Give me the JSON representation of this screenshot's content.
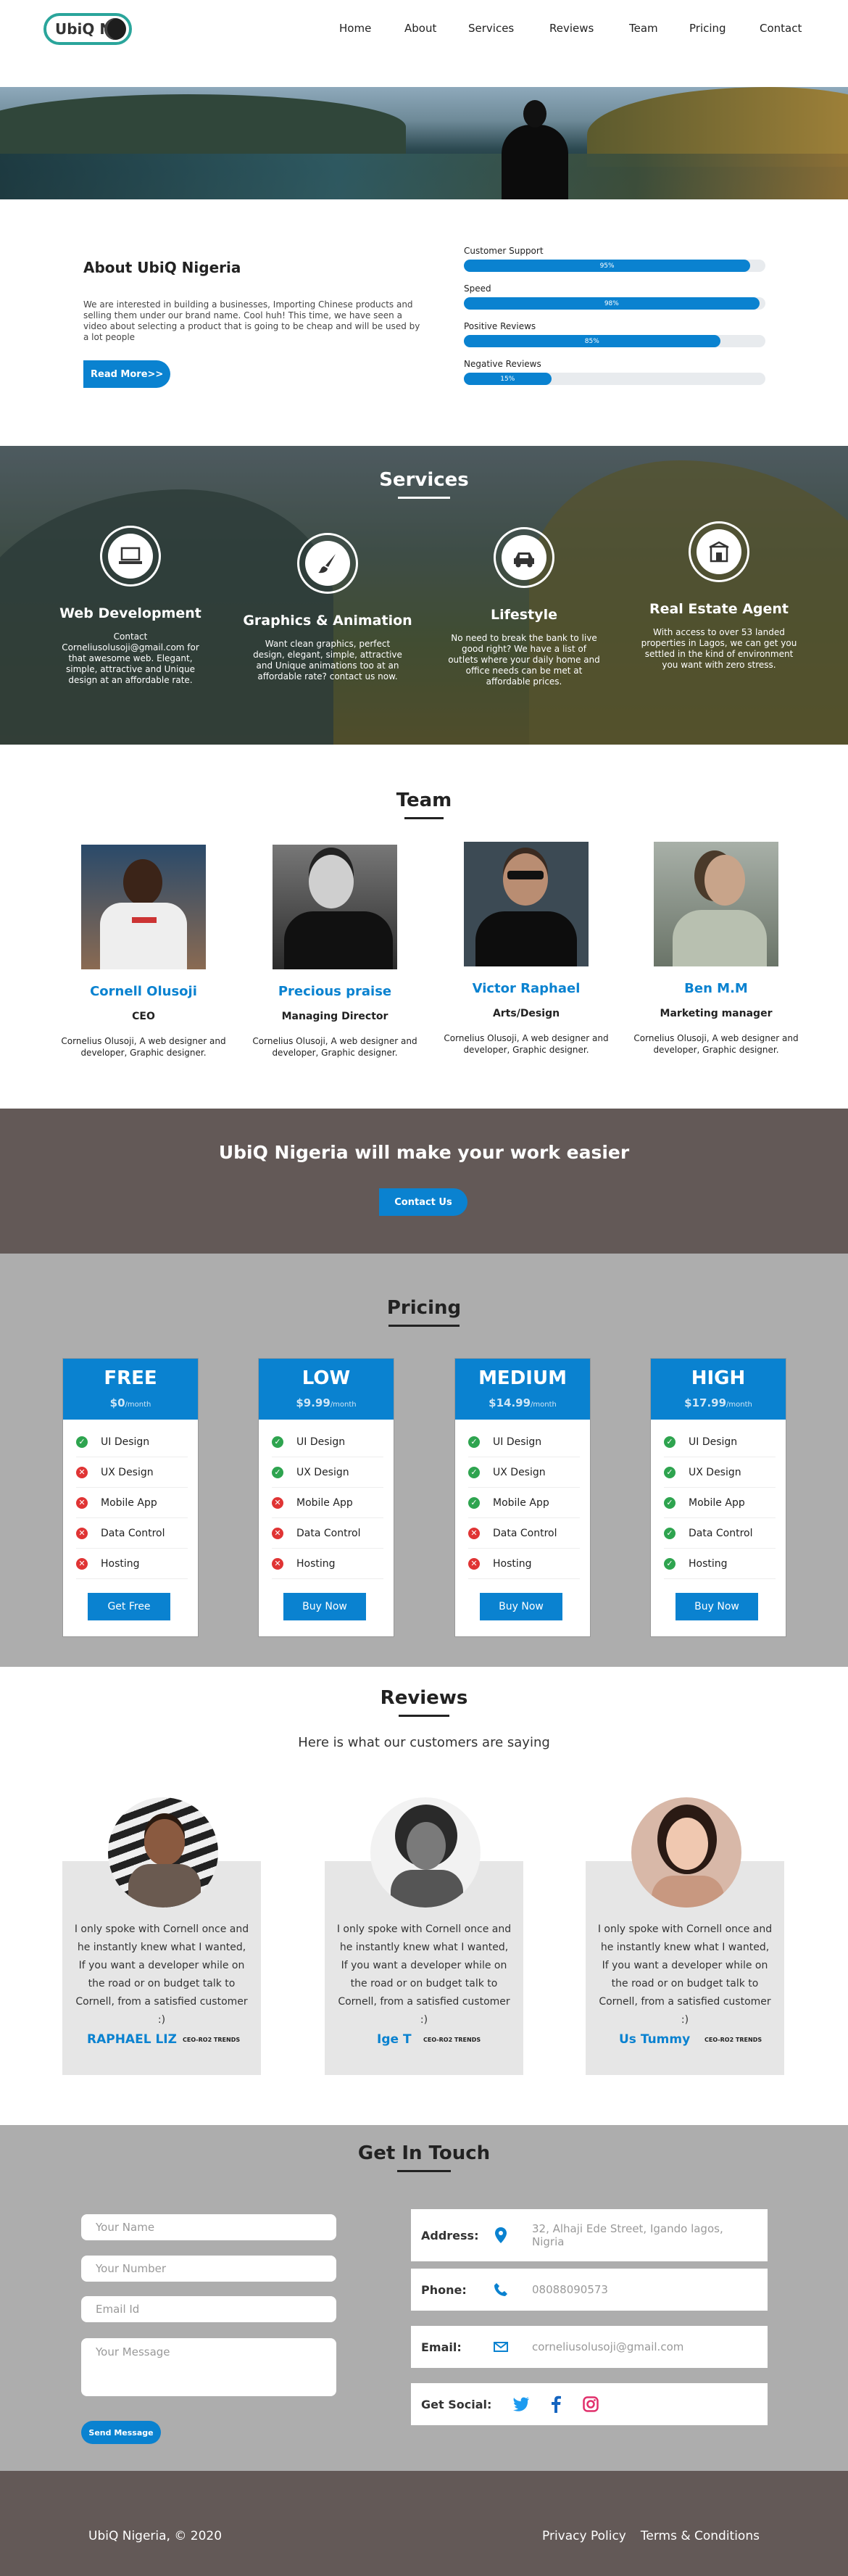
{
  "nav": {
    "logo_text": "UbiQ NG",
    "links": [
      "Home",
      "About",
      "Services",
      "Reviews",
      "Team",
      "Pricing",
      "Contact"
    ]
  },
  "about": {
    "title": "About UbiQ Nigeria",
    "text": "We are interested in building a businesses, Importing Chinese products and selling them under our brand name. Cool huh! This time, we have seen a video about selecting a product that is going to be cheap and will be used by a lot people",
    "button": "Read More>>",
    "skills": [
      {
        "label": "Customer Support",
        "value": "95%",
        "fraction": 0.95
      },
      {
        "label": "Speed",
        "value": "98%",
        "fraction": 0.98
      },
      {
        "label": "Positive Reviews",
        "value": "85%",
        "fraction": 0.85
      },
      {
        "label": "Negative Reviews",
        "value": "15%",
        "fraction": 0.29
      }
    ]
  },
  "services": {
    "title": "Services",
    "items": [
      {
        "title": "Web Development",
        "text": "Contact Corneliusolusoji@gmail.com for that awesome web. Elegant, simple, attractive and Unique design at an affordable rate.",
        "icon": "laptop-icon"
      },
      {
        "title": "Graphics & Animation",
        "text": "Want clean graphics, perfect design, elegant, simple, attractive and Unique animations too at an affordable rate? contact us now.",
        "icon": "paintbrush-icon"
      },
      {
        "title": "Lifestyle",
        "text": "No need to break the bank to live good right? We have a list of outlets where your daily home and office needs can be met at affordable prices.",
        "icon": "car-icon"
      },
      {
        "title": "Real Estate Agent",
        "text": "With access to over 53 landed properties in Lagos, we can get you settled in the kind of environment you want with zero stress.",
        "icon": "house-icon"
      }
    ]
  },
  "team": {
    "title": "Team",
    "members": [
      {
        "name": "Cornell Olusoji",
        "role": "CEO",
        "bio": "Cornelius Olusoji, A web designer and developer, Graphic designer."
      },
      {
        "name": "Precious praise",
        "role": "Managing Director",
        "bio": "Cornelius Olusoji, A web designer and developer, Graphic designer."
      },
      {
        "name": "Victor Raphael",
        "role": "Arts/Design",
        "bio": "Cornelius Olusoji, A web designer and developer, Graphic designer."
      },
      {
        "name": "Ben M.M",
        "role": "Marketing manager",
        "bio": "Cornelius Olusoji, A web designer and developer, Graphic designer."
      }
    ]
  },
  "cta": {
    "title": "UbiQ Nigeria will make your work easier",
    "button": "Contact Us"
  },
  "pricing": {
    "title": "Pricing",
    "features": [
      "UI Design",
      "UX Design",
      "Mobile App",
      "Data Control",
      "Hosting"
    ],
    "plans": [
      {
        "name": "FREE",
        "price": "$0",
        "per": "/month",
        "included": [
          true,
          false,
          false,
          false,
          false
        ],
        "button": "Get Free"
      },
      {
        "name": "LOW",
        "price": "$9.99",
        "per": "/month",
        "included": [
          true,
          true,
          false,
          false,
          false
        ],
        "button": "Buy Now"
      },
      {
        "name": "MEDIUM",
        "price": "$14.99",
        "per": "/month",
        "included": [
          true,
          true,
          true,
          false,
          false
        ],
        "button": "Buy Now"
      },
      {
        "name": "HIGH",
        "price": "$17.99",
        "per": "/month",
        "included": [
          true,
          true,
          true,
          true,
          true
        ],
        "button": "Buy Now"
      }
    ]
  },
  "reviews": {
    "title": "Reviews",
    "subtitle": "Here is what our customers are saying",
    "items": [
      {
        "text": "I only spoke with Cornell once and he instantly knew what I wanted, If you want a developer while on the road or on budget talk to Cornell, from a satisfied customer :)",
        "name": "RAPHAEL LIZ",
        "role": "CEO-RO2 TRENDS"
      },
      {
        "text": "I only spoke with Cornell once and he instantly knew what I wanted, If you want a developer while on the road or on budget talk to Cornell, from a satisfied customer :)",
        "name": "Ige T",
        "role": "CEO-RO2 TRENDS"
      },
      {
        "text": "I only spoke with Cornell once and he instantly knew what I wanted, If you want a developer while on the road or on budget talk to Cornell, from a satisfied customer :)",
        "name": "Us Tummy",
        "role": "CEO-RO2 TRENDS"
      }
    ]
  },
  "contact": {
    "title": "Get In Touch",
    "placeholders": {
      "name": "Your Name",
      "number": "Your Number",
      "email": "Email Id",
      "message": "Your Message"
    },
    "send": "Send Message",
    "address_label": "Address:",
    "address": "32, Alhaji Ede Street, Igando lagos, Nigria",
    "phone_label": "Phone:",
    "phone": "08088090573",
    "email_label": "Email:",
    "email": "corneliusolusoji@gmail.com",
    "social_label": "Get Social:",
    "icons": [
      "twitter-icon",
      "facebook-icon",
      "instagram-icon"
    ]
  },
  "footer": {
    "copyright": "UbiQ Nigeria, © 2020",
    "links": [
      "Privacy Policy",
      "Terms & Conditions"
    ]
  },
  "colors": {
    "accent": "#0a82d0",
    "dark": "#635957",
    "gray": "#adadad",
    "ok": "#2ea44f",
    "no": "#e03434"
  }
}
